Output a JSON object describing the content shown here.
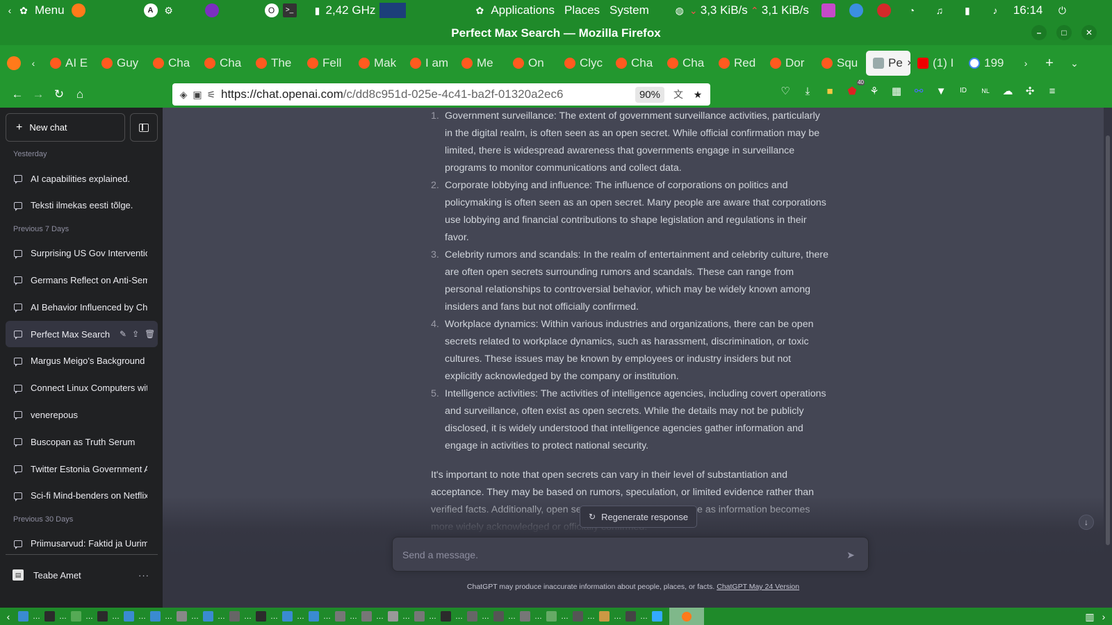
{
  "os_panel": {
    "menu_label": "Menu",
    "cpu_freq": "2,42 GHz",
    "menus": [
      "Applications",
      "Places",
      "System"
    ],
    "net_down": "3,3 KiB/s",
    "net_up": "3,1 KiB/s",
    "clock": "16:14"
  },
  "window": {
    "title": "Perfect Max Search — Mozilla Firefox"
  },
  "tabs": [
    "AI E",
    "Guy",
    "Cha",
    "Cha",
    "The",
    "Fell",
    "Mak",
    "I am",
    "Me",
    "On",
    "Clyc",
    "Cha",
    "Cha",
    "Red",
    "Dor",
    "Squ",
    "Pe",
    "(1) I",
    "199"
  ],
  "active_tab_index": 16,
  "navbar": {
    "url_host": "https://chat.openai.com",
    "url_path": "/c/dd8c951d-025e-4c41-ba2f-01320a2ec6",
    "zoom": "90%",
    "ext_badge_count": "40",
    "ext_nl_label": "NL"
  },
  "sidebar": {
    "new_chat": "New chat",
    "sections": [
      {
        "label": "Yesterday",
        "items": [
          "AI capabilities explained.",
          "Teksti ilmekas eesti tõlge."
        ]
      },
      {
        "label": "Previous 7 Days",
        "items": [
          "Surprising US Gov Intervention",
          "Germans Reflect on Anti-Semiti",
          "AI Behavior Influenced by Chat",
          "Perfect Max Search",
          "Margus Meigo's Background",
          "Connect Linux Computers with",
          "venerepous",
          "Buscopan as Truth Serum",
          "Twitter Estonia Government Acc",
          "Sci-fi Mind-benders on Netflix"
        ]
      },
      {
        "label": "Previous 30 Days",
        "items": [
          "Priimusarvud: Faktid ja Uurimus"
        ]
      }
    ],
    "active_item": "Perfect Max Search",
    "user_name": "Teabe Amet",
    "more_label": "···"
  },
  "answer": {
    "items": [
      {
        "num": "1.",
        "text": "Government surveillance: The extent of government surveillance activities, particularly in the digital realm, is often seen as an open secret. While official confirmation may be limited, there is widespread awareness that governments engage in surveillance programs to monitor communications and collect data."
      },
      {
        "num": "2.",
        "text": "Corporate lobbying and influence: The influence of corporations on politics and policymaking is often seen as an open secret. Many people are aware that corporations use lobbying and financial contributions to shape legislation and regulations in their favor."
      },
      {
        "num": "3.",
        "text": "Celebrity rumors and scandals: In the realm of entertainment and celebrity culture, there are often open secrets surrounding rumors and scandals. These can range from personal relationships to controversial behavior, which may be widely known among insiders and fans but not officially confirmed."
      },
      {
        "num": "4.",
        "text": "Workplace dynamics: Within various industries and organizations, there can be open secrets related to workplace dynamics, such as harassment, discrimination, or toxic cultures. These issues may be known by employees or industry insiders but not explicitly acknowledged by the company or institution."
      },
      {
        "num": "5.",
        "text": "Intelligence activities: The activities of intelligence agencies, including covert operations and surveillance, often exist as open secrets. While the details may not be publicly disclosed, it is widely understood that intelligence agencies gather information and engage in activities to protect national security."
      }
    ],
    "note": "It's important to note that open secrets can vary in their level of substantiation and acceptance. They may be based on rumors, speculation, or limited evidence rather than verified facts. Additionally, open secrets may change over time as information becomes more widely acknowledged or officially confirmed."
  },
  "regenerate_label": "Regenerate response",
  "composer": {
    "placeholder": "Send a message."
  },
  "footer": {
    "text": "ChatGPT may produce inaccurate information about people, places, or facts. ",
    "link": "ChatGPT May 24 Version"
  },
  "colors": {
    "os_green": "#1f8a2a",
    "tab_green": "#23972f",
    "sidebar_bg": "#202123",
    "main_bg": "#444654"
  }
}
